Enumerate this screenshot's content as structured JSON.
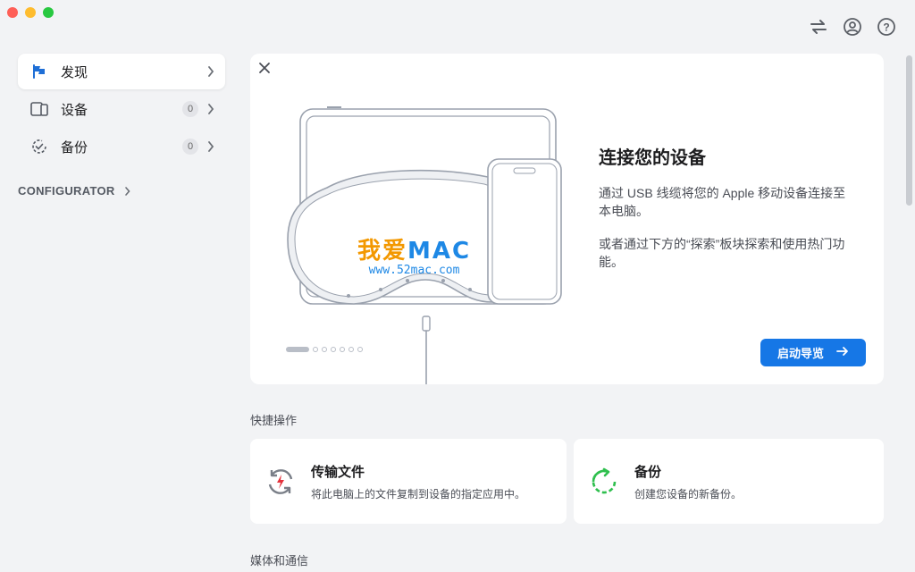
{
  "window": {
    "title": ""
  },
  "toolbar": {
    "icons": [
      "transfer-icon",
      "account-icon",
      "help-icon"
    ]
  },
  "sidebar": {
    "items": [
      {
        "label": "发现",
        "icon": "flag-icon",
        "badge": null,
        "active": true
      },
      {
        "label": "设备",
        "icon": "devices-icon",
        "badge": "0",
        "active": false
      },
      {
        "label": "备份",
        "icon": "backup-icon",
        "badge": "0",
        "active": false
      }
    ],
    "section_label": "CONFIGURATOR"
  },
  "hero": {
    "title": "连接您的设备",
    "paragraph1": "通过 USB 线缆将您的 Apple 移动设备连接至本电脑。",
    "paragraph2": "或者通过下方的“探索”板块探索和使用热门功能。",
    "button_label": "启动导览",
    "pager": {
      "total": 7,
      "current": 1
    },
    "watermark": {
      "cn": "我爱",
      "en": "MAC",
      "url": "www.52mac.com"
    }
  },
  "quick_actions": {
    "title": "快捷操作",
    "cards": [
      {
        "title": "传输文件",
        "desc": "将此电脑上的文件复制到设备的指定应用中。",
        "icon": "transfer-files-icon"
      },
      {
        "title": "备份",
        "desc": "创建您设备的新备份。",
        "icon": "backup-icon"
      }
    ]
  },
  "media": {
    "title": "媒体和通信"
  },
  "colors": {
    "accent": "#1677e6",
    "sidebar_icon": "#1f6fd6",
    "backup_green": "#2fbf4e",
    "transfer_red": "#e5323c"
  }
}
